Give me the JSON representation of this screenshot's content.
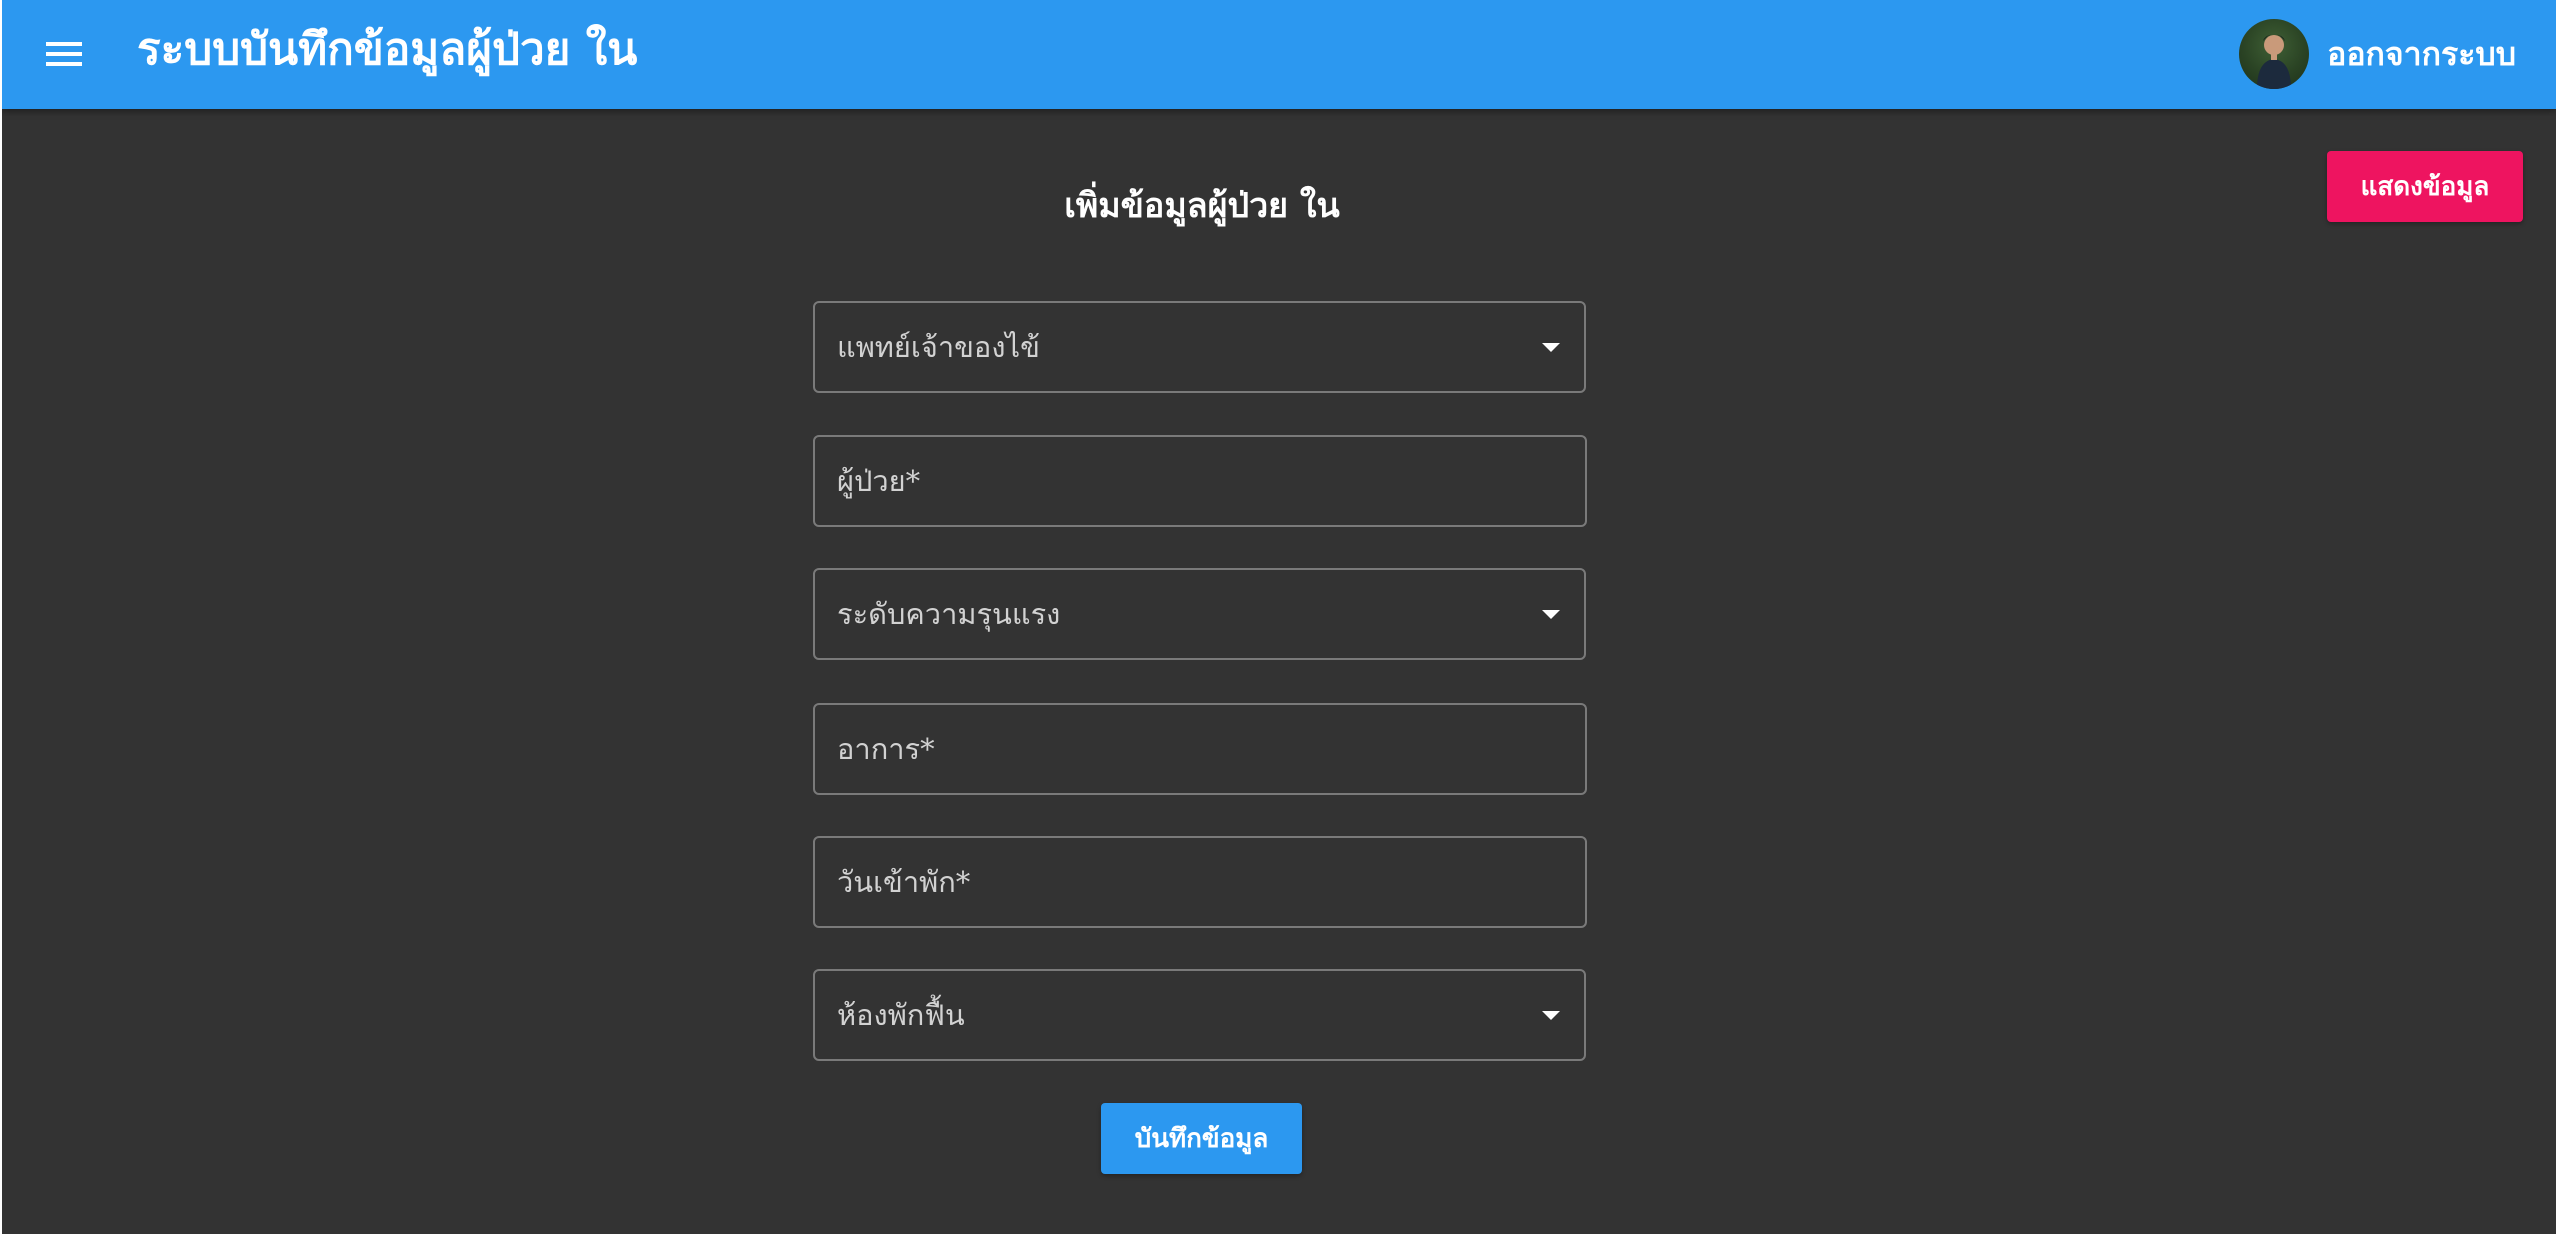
{
  "header": {
    "title": "ระบบบันทึกข้อมูลผู้ป่วย ใน",
    "logout_label": "ออกจากระบบ",
    "menu_icon": "menu-icon",
    "color": "#2c98f0"
  },
  "actions": {
    "show_data_label": "แสดงข้อมูล",
    "show_data_color": "#ee1460",
    "save_label": "บันทึกข้อมูล"
  },
  "form": {
    "title": "เพิ่มข้อมูลผู้ป่วย ใน",
    "fields": [
      {
        "label": "แพทย์เจ้าของไข้",
        "type": "select"
      },
      {
        "label": "ผู้ป่วย*",
        "type": "text"
      },
      {
        "label": "ระดับความรุนแรง",
        "type": "select"
      },
      {
        "label": "อาการ*",
        "type": "text"
      },
      {
        "label": "วันเข้าพัก*",
        "type": "text"
      },
      {
        "label": "ห้องพักฟื้น",
        "type": "select"
      }
    ]
  },
  "theme": {
    "background": "#333333"
  }
}
